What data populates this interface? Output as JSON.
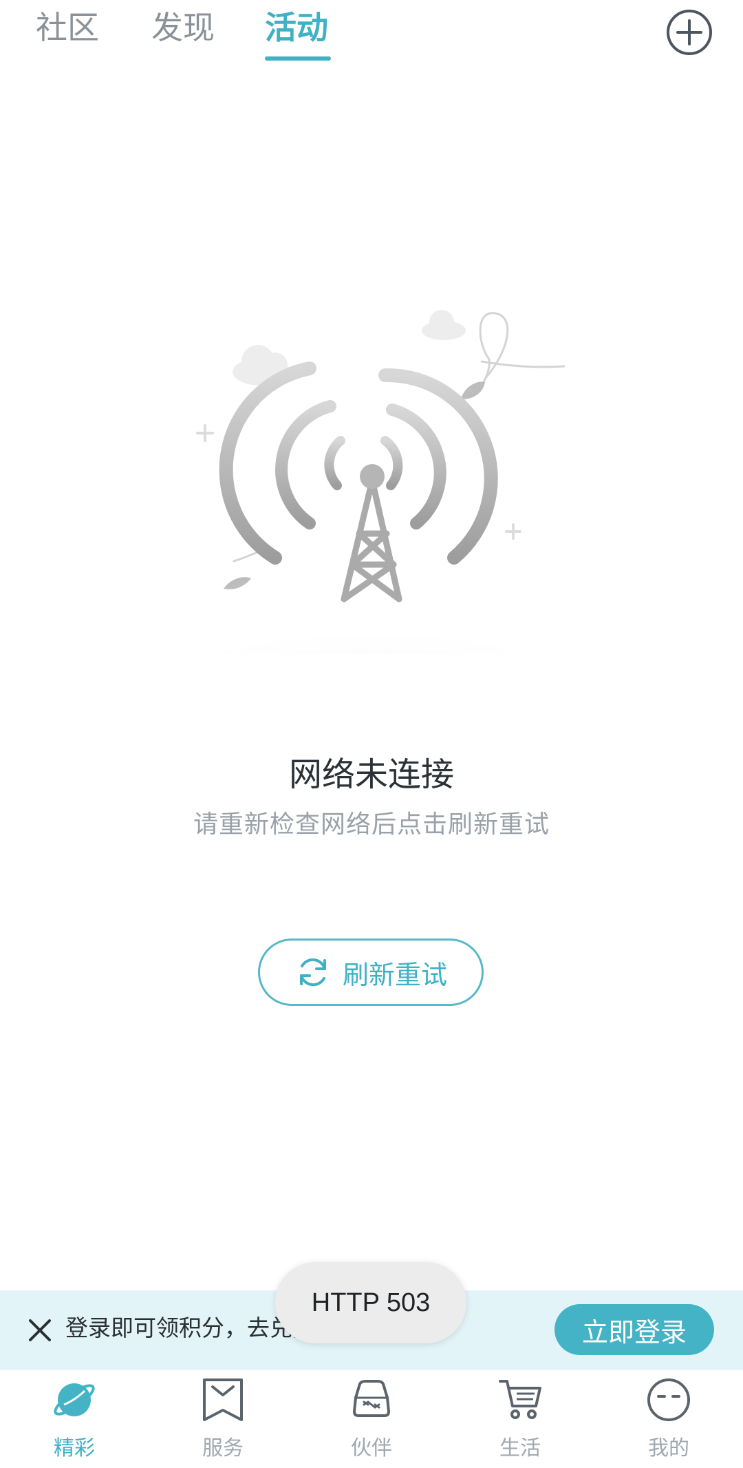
{
  "top_tabs": [
    {
      "label": "社区"
    },
    {
      "label": "发现"
    },
    {
      "label": "活动",
      "active": true
    }
  ],
  "accent_color": "#3fb1c4",
  "add_button_icon": "plus-circle-icon",
  "empty_state": {
    "illustration": "broken-signal-tower",
    "title": "网络未连接",
    "subtitle": "请重新检查网络后点击刷新重试",
    "retry_label": "刷新重试",
    "retry_icon": "refresh-icon"
  },
  "login_banner": {
    "text": "登录即可领积分，去兑换精美好礼!",
    "button_label": "立即登录",
    "close_icon": "close-icon"
  },
  "toast": {
    "text": "HTTP 503"
  },
  "bottom_nav": [
    {
      "label": "精彩",
      "icon": "planet-icon",
      "active": true
    },
    {
      "label": "服务",
      "icon": "bookmark-icon"
    },
    {
      "label": "伙伴",
      "icon": "car-icon"
    },
    {
      "label": "生活",
      "icon": "cart-icon"
    },
    {
      "label": "我的",
      "icon": "face-icon"
    }
  ]
}
